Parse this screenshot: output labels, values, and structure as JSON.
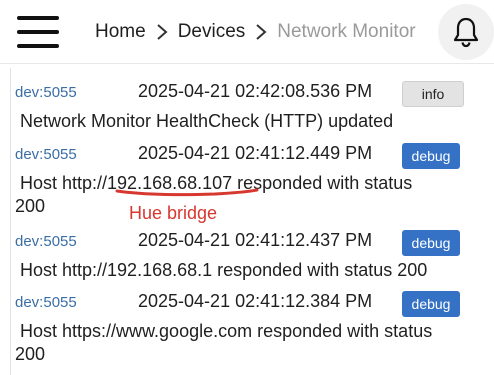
{
  "header": {
    "menu_icon": "hamburger-menu-icon",
    "breadcrumb": [
      "Home",
      "Devices",
      "Network Monitor"
    ],
    "bell_icon": "bell-icon"
  },
  "logs": [
    {
      "source": "dev:5055",
      "time": "2025-04-21 02:42:08.536 PM",
      "level": "info",
      "message": "Network Monitor HealthCheck (HTTP) updated"
    },
    {
      "source": "dev:5055",
      "time": "2025-04-21 02:41:12.449 PM",
      "level": "debug",
      "message_line1": "Host http://192.168.68.107 responded with status",
      "message_line2": "200"
    },
    {
      "source": "dev:5055",
      "time": "2025-04-21 02:41:12.437 PM",
      "level": "debug",
      "message": "Host http://192.168.68.1 responded with status 200"
    },
    {
      "source": "dev:5055",
      "time": "2025-04-21 02:41:12.384 PM",
      "level": "debug",
      "message_line1": "Host https://www.google.com responded with status",
      "message_line2": "200"
    }
  ],
  "annotation": {
    "text": "Hue bridge",
    "color": "#d6382f"
  },
  "colors": {
    "debug_badge": "#3572c6",
    "info_badge": "#e3e3e3",
    "source_link": "#3a6ea5"
  }
}
